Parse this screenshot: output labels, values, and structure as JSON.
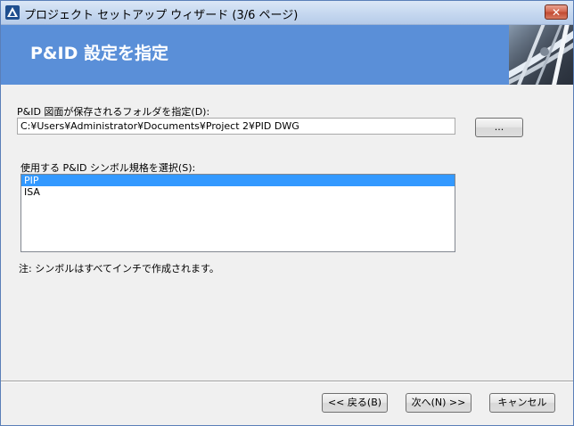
{
  "window": {
    "title": "プロジェクト セットアップ ウィザード (3/6 ページ)",
    "close_label": "✕"
  },
  "banner": {
    "title": "P&ID 設定を指定"
  },
  "folder": {
    "label": "P&ID 図面が保存されるフォルダを指定(D):",
    "value": "C:¥Users¥Administrator¥Documents¥Project 2¥PID DWG",
    "browse_label": "..."
  },
  "standard": {
    "label": "使用する P&ID シンボル規格を選択(S):",
    "items": [
      "PIP",
      "ISA"
    ],
    "selected": "PIP"
  },
  "note": "注: シンボルはすべてインチで作成されます。",
  "footer": {
    "back_label": "<< 戻る(B)",
    "next_label": "次へ(N) >>",
    "cancel_label": "キャンセル"
  },
  "colors": {
    "banner": "#5a8fd8",
    "selection": "#3399ff"
  }
}
